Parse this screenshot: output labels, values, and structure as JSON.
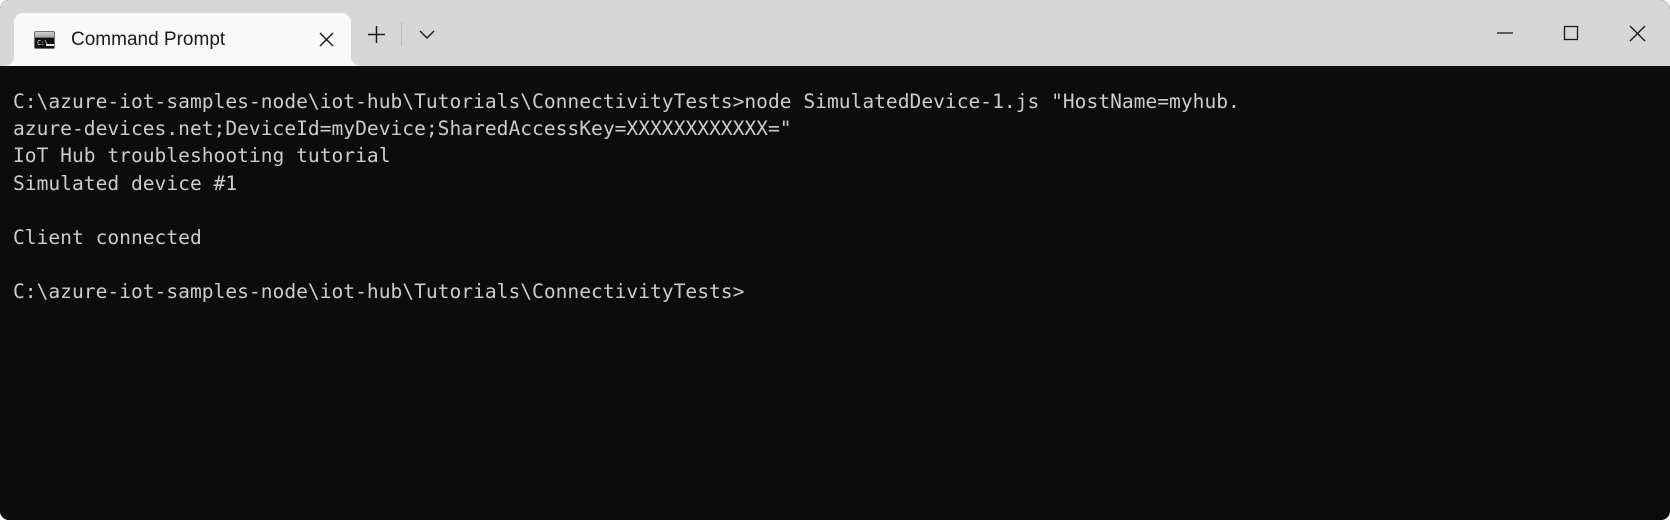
{
  "window": {
    "title": "Command Prompt",
    "titlebar_color": "#d6d6d6",
    "tab_color": "#f9f9f9",
    "terminal_bg": "#0c0c0c",
    "terminal_fg": "#cccccc"
  },
  "tab": {
    "label": "Command Prompt",
    "icon": "command-prompt-icon",
    "icon_prompt_text": "C:\\",
    "close_icon": "close-icon"
  },
  "toolbar": {
    "new_tab_icon": "plus-icon",
    "new_tab_label": "+",
    "dropdown_icon": "chevron-down-icon"
  },
  "window_controls": {
    "minimize": "minimize-icon",
    "maximize": "maximize-icon",
    "close": "close-icon"
  },
  "terminal": {
    "lines": [
      "C:\\azure-iot-samples-node\\iot-hub\\Tutorials\\ConnectivityTests>node SimulatedDevice-1.js \"HostName=myhub.",
      "azure-devices.net;DeviceId=myDevice;SharedAccessKey=XXXXXXXXXXXX=\"",
      "IoT Hub troubleshooting tutorial",
      "Simulated device #1",
      "",
      "Client connected",
      "",
      "C:\\azure-iot-samples-node\\iot-hub\\Tutorials\\ConnectivityTests>"
    ]
  }
}
